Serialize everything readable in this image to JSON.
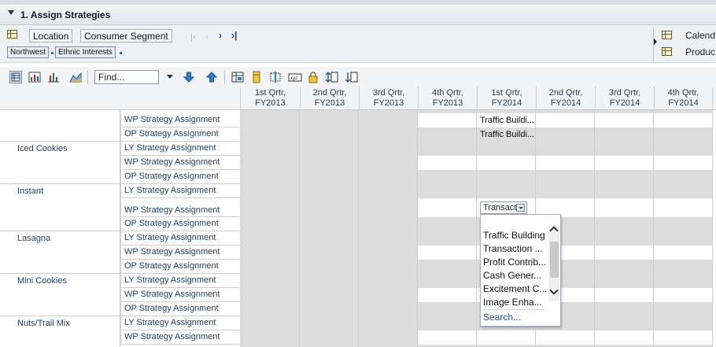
{
  "panel": {
    "title": "1. Assign Strategies"
  },
  "dimensions": {
    "location_label": "Location",
    "segment_label": "Consumer Segment",
    "crumb_location": "Northwest",
    "crumb_segment": "Ethnic Interests",
    "right_items": [
      "Calend",
      "Produc"
    ]
  },
  "toolbar": {
    "find_placeholder": "Find..."
  },
  "columns": [
    "1st Qrtr, FY2013",
    "2nd Qrtr, FY2013",
    "3rd Qrtr, FY2013",
    "4th Qrtr, FY2013",
    "1st Qrtr, FY2014",
    "2nd Qrtr, FY2014",
    "3rd Qrtr, FY2014",
    "4th Qrtr, FY2014"
  ],
  "products": [
    "Iced Cookies",
    "Instant",
    "Lasagna",
    "Mini Cookies",
    "Nuts/Trail Mix"
  ],
  "measures": {
    "ly": "LY Strategy Assignment",
    "wp": "WP Strategy Assignment",
    "op": "OP Strategy Assignment"
  },
  "cell_values": {
    "wp_top": "Traffic Buildi...",
    "op_top": "Traffic Buildi...",
    "instant_wp": "Transact"
  },
  "dropdown": {
    "options": [
      "",
      "Traffic Building",
      "Transaction ...",
      "Profit Contrib...",
      "Cash Gener...",
      "Excitement C...",
      "Image Enha..."
    ],
    "search_label": "Search..."
  },
  "colors": {
    "locked": "#dcdcdc",
    "editable": "#ffffff",
    "label": "#23435f"
  }
}
